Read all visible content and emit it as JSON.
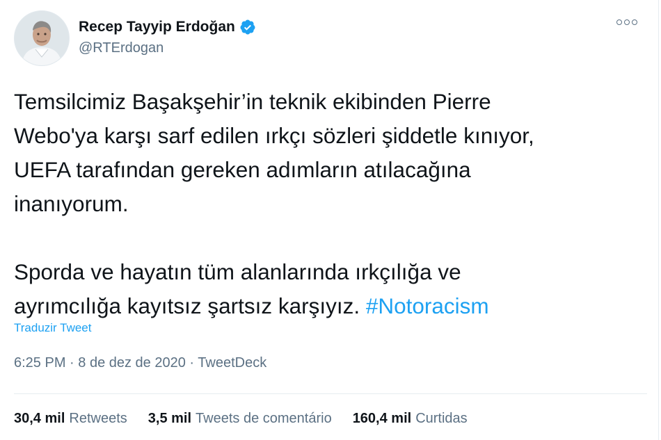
{
  "author": {
    "name": "Recep Tayyip Erdoğan",
    "handle": "@RTErdogan",
    "avatar_icon": "profile-photo",
    "verified_icon": "verified-badge-icon"
  },
  "tweet": {
    "paragraph1": "Temsilcimiz Başakşehir’in teknik ekibinden Pierre\nWebo'ya karşı sarf edilen ırkçı sözleri şiddetle kınıyor,\nUEFA tarafından gereken adımların atılacağına\ninanıyorum.",
    "paragraph2": "Sporda ve hayatın tüm alanlarında ırkçılığa ve\nayrımcılığa kayıtsız şartsız karşıyız. ",
    "hashtag": "#Notoracism",
    "translate_label": "Traduzir Tweet",
    "time": "6:25 PM",
    "separator": " · ",
    "date": "8 de dez de 2020",
    "source": "TweetDeck"
  },
  "stats": {
    "retweets_count": "30,4 mil",
    "retweets_label": "Retweets",
    "quotes_count": "3,5 mil",
    "quotes_label": "Tweets de comentário",
    "likes_count": "160,4 mil",
    "likes_label": "Curtidas"
  },
  "colors": {
    "link": "#1da1f2",
    "secondary_text": "#5b7083",
    "primary_text": "#0f1419",
    "verified": "#1da1f2"
  }
}
